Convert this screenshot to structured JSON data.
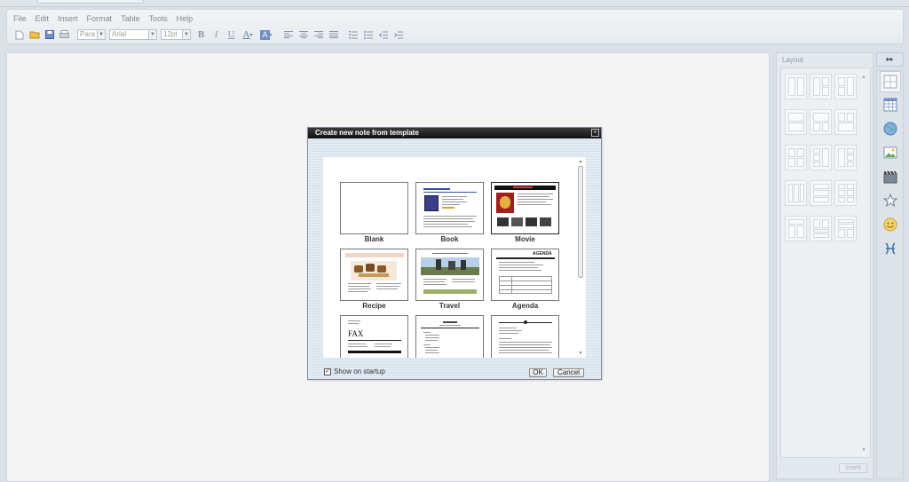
{
  "menu": [
    "File",
    "Edit",
    "Insert",
    "Format",
    "Table",
    "Tools",
    "Help"
  ],
  "toolbar": {
    "paragraph_style": "Para",
    "font_family": "Arial",
    "font_size": "12pt",
    "bold_label": "B",
    "italic_label": "I",
    "underline_label": "U",
    "font_color_label": "A",
    "highlight_label": "A"
  },
  "layout_panel": {
    "title": "Layout",
    "insert_label": "Insert"
  },
  "dialog": {
    "title": "Create new note from template",
    "close_label": "×",
    "templates": [
      {
        "label": "Blank"
      },
      {
        "label": "Book"
      },
      {
        "label": "Movie"
      },
      {
        "label": "Recipe"
      },
      {
        "label": "Travel"
      },
      {
        "label": "Agenda"
      },
      {
        "label": ""
      },
      {
        "label": ""
      },
      {
        "label": ""
      }
    ],
    "show_on_startup_label": "Show on startup",
    "show_on_startup_checked": "✓",
    "ok_label": "OK",
    "cancel_label": "Cancel",
    "thumb_fax_text": "FAX",
    "thumb_agenda_text": "AGENDA"
  },
  "colors": {
    "titlebar": "#111111",
    "editor_bg": "#f4f4f4",
    "chrome_bg": "#d9e0e7",
    "accent_blue": "#2d4fa3"
  }
}
